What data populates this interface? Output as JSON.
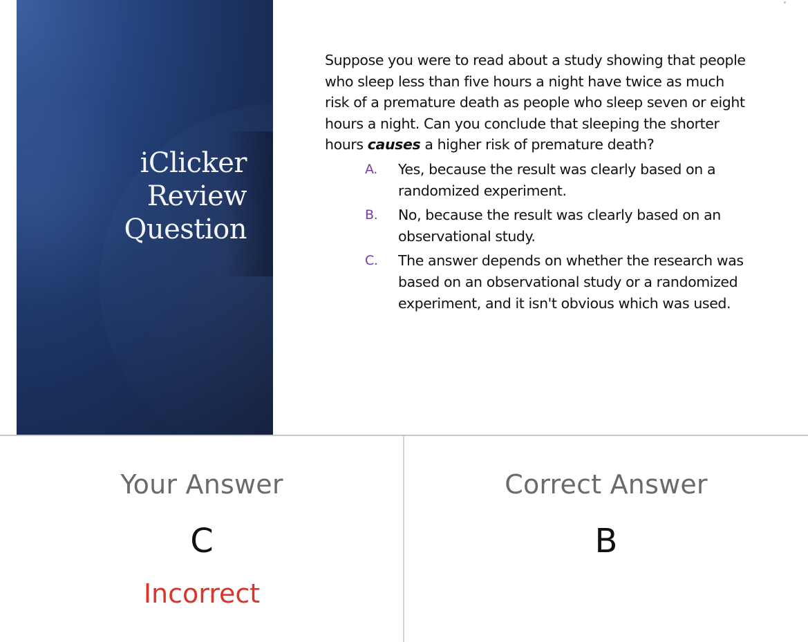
{
  "slide": {
    "title_lines": [
      "iClicker",
      "Review",
      "Question"
    ],
    "question_before": "Suppose you were to read about a study showing that people who sleep less than five hours a night have twice as much risk of a premature death as people who sleep seven or eight hours a night. Can you conclude that sleeping the shorter hours ",
    "question_emphasis": "causes",
    "question_after": " a higher risk of premature death?",
    "options": [
      {
        "letter": "A.",
        "text": "Yes, because the result was clearly based on a randomized experiment."
      },
      {
        "letter": "B.",
        "text": "No, because the result was clearly based on an observational study."
      },
      {
        "letter": "C.",
        "text": "The answer depends on whether the research was based on an observational study or a randomized experiment, and it isn't obvious which was used."
      }
    ],
    "colors": {
      "option_letter": "#7a3aa4",
      "panel": "#1a2f5a"
    }
  },
  "answers": {
    "your_answer": {
      "heading": "Your Answer",
      "value": "C",
      "status": "Incorrect"
    },
    "correct_answer": {
      "heading": "Correct Answer",
      "value": "B"
    },
    "colors": {
      "incorrect": "#d9352a",
      "heading": "#6a6a6a"
    }
  }
}
